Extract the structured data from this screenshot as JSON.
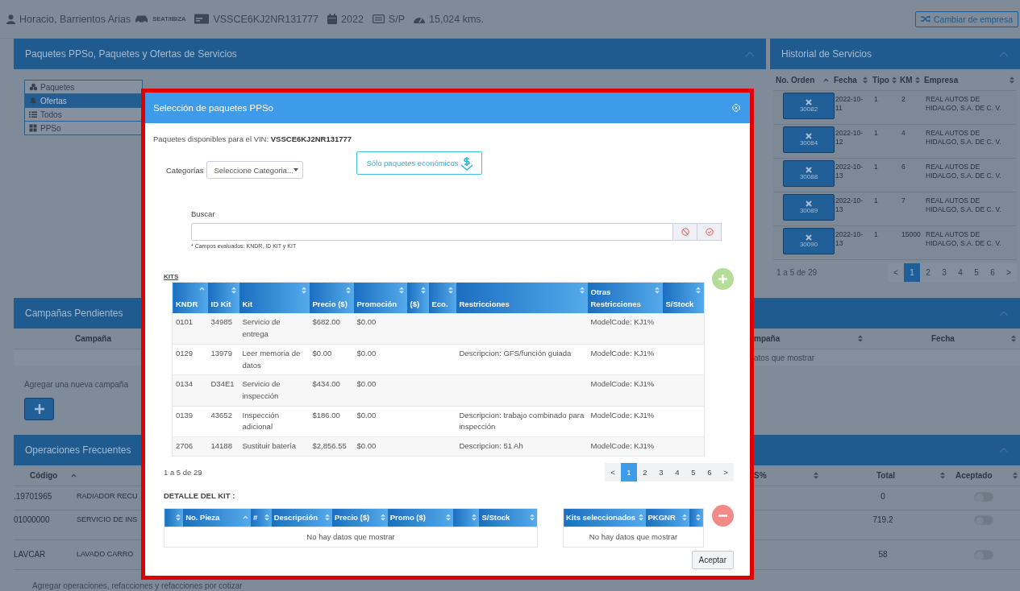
{
  "vehicle_bar": {
    "owner": "Horacio, Barrientos Arias",
    "model": "SEAT/IBIZA",
    "vin": "VSSCE6KJ2NR131777",
    "year": "2022",
    "plate": "S/P",
    "mileage": "15,024 kms."
  },
  "change_company_button": "Cambiar de empresa",
  "packages_panel": {
    "title": "Paquetes PPSo, Paquetes y Ofertas de Servicios",
    "menu": [
      {
        "label": "Paquetes",
        "selected": false
      },
      {
        "label": "Ofertas",
        "selected": true
      },
      {
        "label": "Todos",
        "selected": false
      },
      {
        "label": "PPSo",
        "selected": false
      }
    ]
  },
  "history_panel": {
    "title": "Historial de Servicios",
    "columns": [
      {
        "label": "No. Orden",
        "sorted": true
      },
      {
        "label": "Fecha",
        "sorted": false
      },
      {
        "label": "Tipo",
        "sorted": false
      },
      {
        "label": "KM",
        "sorted": false
      },
      {
        "label": "Empresa",
        "sorted": false
      }
    ],
    "rows": [
      {
        "order": "30082",
        "date": "2022-10-11",
        "type": "1",
        "km": "2",
        "company": "REAL AUTOS DE HIDALGO, S.A. DE C. V."
      },
      {
        "order": "30084",
        "date": "2022-10-12",
        "type": "1",
        "km": "4",
        "company": "REAL AUTOS DE HIDALGO, S.A. DE C. V."
      },
      {
        "order": "30088",
        "date": "2022-10-13",
        "type": "1",
        "km": "6",
        "company": "REAL AUTOS DE HIDALGO, S.A. DE C. V."
      },
      {
        "order": "30089",
        "date": "2022-10-13",
        "type": "1",
        "km": "7",
        "company": "REAL AUTOS DE HIDALGO, S.A. DE C. V."
      },
      {
        "order": "30090",
        "date": "2022-10-13",
        "type": "1",
        "km": "15000",
        "company": "REAL AUTOS DE HIDALGO, S.A. DE C. V."
      }
    ],
    "summary": "1 a 5 de 29",
    "pages": [
      {
        "label": "<",
        "selected": false
      },
      {
        "label": "1",
        "selected": true
      },
      {
        "label": "2",
        "selected": false
      },
      {
        "label": "3",
        "selected": false
      },
      {
        "label": "4",
        "selected": false
      },
      {
        "label": "5",
        "selected": false
      },
      {
        "label": "6",
        "selected": false
      },
      {
        "label": ">",
        "selected": false
      }
    ]
  },
  "campaigns_panel": {
    "title": "Campañas Pendientes",
    "left_column": "Campaña",
    "right_columns": [
      {
        "label": "mpaña",
        "sorted": false
      },
      {
        "label": "Fecha",
        "sorted": false
      }
    ],
    "empty_text": "atos que mostrar",
    "add_label": "Agregar una nueva campaña"
  },
  "operations_panel": {
    "title": "Operaciones Frecuentes",
    "left_column": {
      "label": "Código",
      "sorted": true
    },
    "right_columns": [
      {
        "label": "S%",
        "sorted": false
      },
      {
        "label": "Total",
        "sorted": false
      },
      {
        "label": "Aceptado",
        "sorted": false
      }
    ],
    "rows": [
      {
        "code": ".19701965",
        "description": "RADIADOR RECU",
        "total": "0",
        "accepted": false
      },
      {
        "code": "01000000",
        "description": "SERVICIO DE INS",
        "total": "719.2",
        "accepted": false
      },
      {
        "code": "LAVCAR",
        "description": "LAVADO CARRO",
        "total": "58",
        "accepted": false
      }
    ],
    "footer_text": "Agregar operaciones, refacciones y refacciones por cotizar"
  },
  "modal": {
    "title": "Selección de paquetes PPSo",
    "vin_text": "Paquetes disponibles para el VIN: **VSSCE6KJ2NR131777**",
    "categories_label": "Categorías",
    "categories_select": "Seleccione Categoria...",
    "economy_button": "Sólo paquetes económicos",
    "search_label": "Buscar",
    "search_hint": "* Campos evaluados: KNDR, ID KIT y KIT",
    "kits_label": "KITS",
    "kits_columns": [
      {
        "label": "KNDR",
        "sorted": true
      },
      {
        "label": "ID Kit",
        "sorted": false
      },
      {
        "label": "Kit",
        "sorted": false
      },
      {
        "label": "Precio ($)",
        "sorted": false
      },
      {
        "label": "Promoción",
        "sorted": false
      },
      {
        "label": "($)",
        "sorted": false
      },
      {
        "label": "Eco.",
        "sorted": false
      },
      {
        "label": "Restricciones",
        "sorted": false
      },
      {
        "label": "Otras Restricciones",
        "sorted": false
      },
      {
        "label": "S/Stock",
        "sorted": false
      }
    ],
    "kits_rows": [
      {
        "kndr": "0101",
        "id_kit": "34985",
        "kit": "Servicio de entrega",
        "price": "$682.00",
        "promo": "$0.00",
        "other_restrictions": "ModelCode: KJ1%"
      },
      {
        "kndr": "0129",
        "id_kit": "13979",
        "kit": "Leer memoria de datos",
        "price": "$0.00",
        "promo": "$0.00",
        "restrictions": "Descripcion: GFS/función guiada",
        "other_restrictions": "ModelCode: KJ1%"
      },
      {
        "kndr": "0134",
        "id_kit": "D34E1",
        "kit": "Servicio de inspección",
        "price": "$434.00",
        "promo": "$0.00",
        "other_restrictions": "ModelCode: KJ1%"
      },
      {
        "kndr": "0139",
        "id_kit": "43652",
        "kit": "Inspección adicional",
        "price": "$186.00",
        "promo": "$0.00",
        "restrictions": "Descripcion: trabajo combinado para inspección",
        "other_restrictions": "ModelCode: KJ1%"
      },
      {
        "kndr": "2706",
        "id_kit": "14188",
        "kit": "Sustituir batería",
        "price": "$2,856.55",
        "promo": "$0.00",
        "restrictions": "Descripcion: 51 Ah",
        "other_restrictions": "ModelCode: KJ1%"
      }
    ],
    "kits_summary": "1 a 5 de 29",
    "kits_pages": [
      {
        "label": "<",
        "selected": false
      },
      {
        "label": "1",
        "selected": true
      },
      {
        "label": "2",
        "selected": false
      },
      {
        "label": "3",
        "selected": false
      },
      {
        "label": "4",
        "selected": false
      },
      {
        "label": "5",
        "selected": false
      },
      {
        "label": "6",
        "selected": false
      },
      {
        "label": ">",
        "selected": false
      }
    ],
    "detail_label": "DETALLE DEL KIT :",
    "detail_columns": [
      {
        "sorted": false
      },
      {
        "label": "No. Pieza",
        "sorted": true
      },
      {
        "label": "#",
        "sorted": false
      },
      {
        "label": "Descripción",
        "sorted": false
      },
      {
        "label": "Precio ($)",
        "sorted": false
      },
      {
        "label": "Promo ($)",
        "sorted": false
      },
      {
        "sorted": false
      },
      {
        "label": "S/Stock",
        "sorted": false
      }
    ],
    "detail_empty": "No hay datos que mostrar",
    "selected_columns": [
      {
        "label": "Kits seleccionados",
        "sorted": false
      },
      {
        "label": "PKGNR",
        "sorted": false
      },
      {
        "sorted": false
      }
    ],
    "selected_empty": "No hay datos que mostrar",
    "accept_button": "Aceptar"
  }
}
